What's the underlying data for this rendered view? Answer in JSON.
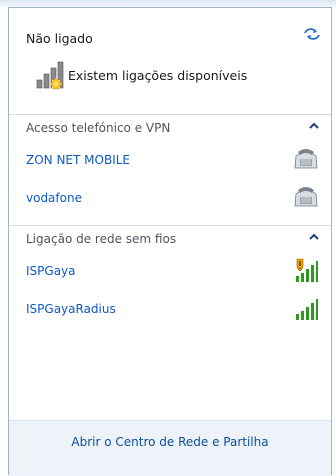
{
  "status": {
    "title": "Não ligado",
    "available_text": "Existem ligações disponíveis"
  },
  "groups": [
    {
      "header": "Acesso telefónico e VPN",
      "items": [
        {
          "label": "ZON NET MOBILE",
          "icon": "dialup-modem-icon"
        },
        {
          "label": "vodafone",
          "icon": "dialup-modem-icon"
        }
      ]
    },
    {
      "header": "Ligação de rede sem fios",
      "items": [
        {
          "label": "ISPGaya",
          "icon": "wifi-signal-shield-icon"
        },
        {
          "label": "ISPGayaRadius",
          "icon": "wifi-signal-icon"
        }
      ]
    }
  ],
  "footer": {
    "link_label": "Abrir o Centro de Rede e Partilha"
  },
  "colors": {
    "link": "#0d5ac6",
    "header_text": "#4e5561",
    "footer_bg": "#eef3fa",
    "signal_green": "#2f9b1e",
    "warning_orange": "#f0a400"
  }
}
